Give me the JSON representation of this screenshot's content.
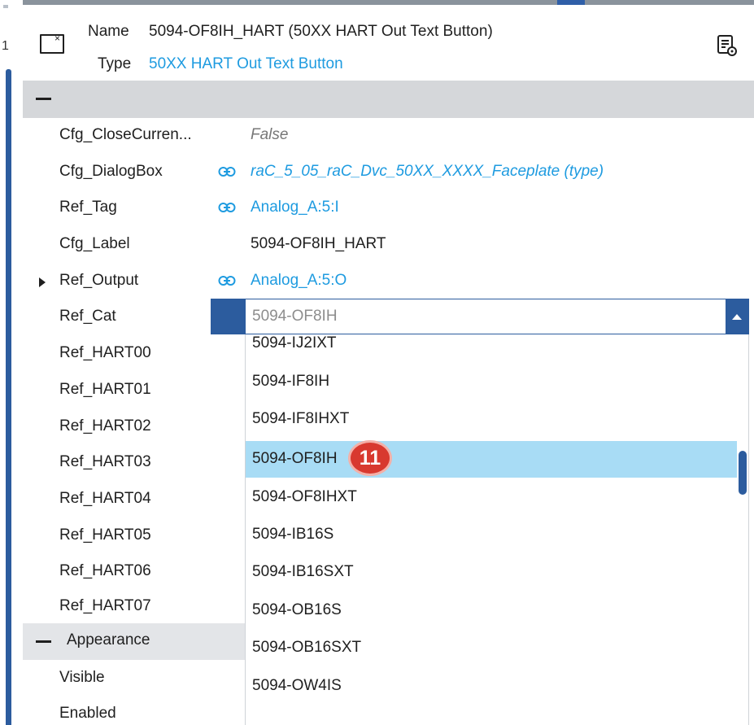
{
  "gutter": {
    "number": "1"
  },
  "header": {
    "name_label": "Name",
    "name_value": "5094-OF8IH_HART (50XX HART Out Text Button)",
    "type_label": "Type",
    "type_value": "50XX HART Out Text Button",
    "icons": {
      "object": "text-button-icon",
      "settings": "property-settings-icon"
    }
  },
  "properties": [
    {
      "label": "Cfg_CloseCurren...",
      "value": "False",
      "style": "muted"
    },
    {
      "label": "Cfg_DialogBox",
      "value": "raC_5_05_raC_Dvc_50XX_XXXX_Faceplate (type)",
      "style": "link-italic",
      "linked": true
    },
    {
      "label": "Ref_Tag",
      "value": "Analog_A:5:I",
      "style": "link",
      "linked": true
    },
    {
      "label": "Cfg_Label",
      "value": "5094-OF8IH_HART",
      "style": "plain"
    },
    {
      "label": "Ref_Output",
      "value": "Analog_A:5:O",
      "style": "link",
      "linked": true,
      "expandable": true
    },
    {
      "label": "Ref_Cat",
      "value": ""
    },
    {
      "label": "Ref_HART00",
      "value": ""
    },
    {
      "label": "Ref_HART01",
      "value": ""
    },
    {
      "label": "Ref_HART02",
      "value": ""
    },
    {
      "label": "Ref_HART03",
      "value": ""
    },
    {
      "label": "Ref_HART04",
      "value": ""
    },
    {
      "label": "Ref_HART05",
      "value": ""
    },
    {
      "label": "Ref_HART06",
      "value": ""
    },
    {
      "label": "Ref_HART07",
      "value": ""
    }
  ],
  "appearance": {
    "title": "Appearance",
    "items": [
      "Visible",
      "Enabled"
    ]
  },
  "combo": {
    "current_value": "5094-OF8IH",
    "options": [
      "5094-IJ2IXT",
      "5094-IF8IH",
      "5094-IF8IHXT",
      "5094-OF8IH",
      "5094-OF8IHXT",
      "5094-IB16S",
      "5094-IB16SXT",
      "5094-OB16S",
      "5094-OB16SXT",
      "5094-OW4IS"
    ],
    "selected_index": 3
  },
  "badge": {
    "label": "11"
  },
  "colors": {
    "accent": "#2c5c9e",
    "link": "#1e9be0",
    "selection": "#a8dcf5",
    "badge": "#d8392f",
    "section_bar": "#d5d7da"
  }
}
